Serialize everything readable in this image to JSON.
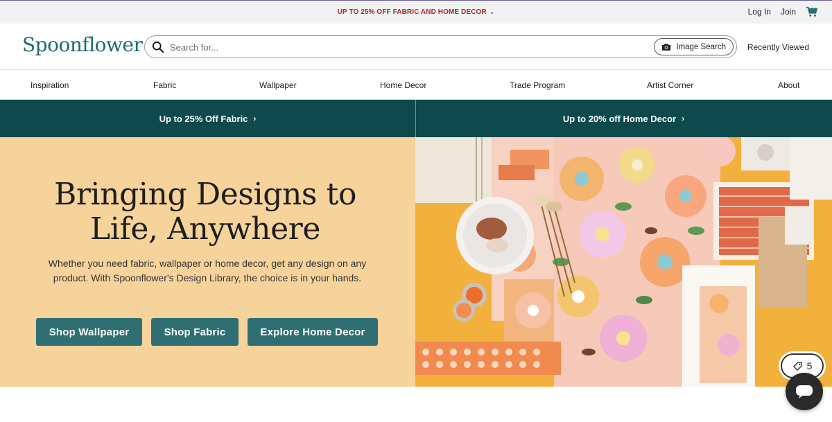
{
  "promo_bar": {
    "text": "UP TO 25% OFF FABRIC AND HOME DECOR",
    "chevron_icon": "chevron-down-icon"
  },
  "account": {
    "login": "Log In",
    "join": "Join",
    "cart_icon": "cart-icon"
  },
  "header": {
    "logo": "Spoonflower",
    "search": {
      "placeholder": "Search for...",
      "value": "",
      "image_search_label": "Image Search"
    },
    "recently_viewed": "Recently Viewed"
  },
  "nav": {
    "items": [
      {
        "label": "Inspiration"
      },
      {
        "label": "Fabric"
      },
      {
        "label": "Wallpaper"
      },
      {
        "label": "Home Decor"
      },
      {
        "label": "Trade Program"
      },
      {
        "label": "Artist Corner"
      },
      {
        "label": "About"
      }
    ]
  },
  "banners": [
    {
      "label": "Up to 25% Off Fabric"
    },
    {
      "label": "Up to 20% off Home Decor"
    }
  ],
  "hero": {
    "title": "Bringing Designs to Life, Anywhere",
    "text": "Whether you need fabric, wallpaper or home decor, get any design on any product. With Spoonflower's Design Library, the choice is in your hands.",
    "buttons": [
      {
        "label": "Shop Wallpaper"
      },
      {
        "label": "Shop Fabric"
      },
      {
        "label": "Explore Home Decor"
      }
    ]
  },
  "coupon_badge": {
    "count": "5",
    "icon": "tag-icon"
  },
  "chat": {
    "icon": "chat-bubble-icon"
  },
  "colors": {
    "brand_teal": "#1d6b6b",
    "banner_bg": "#0e4a4c",
    "hero_bg": "#f5d39b",
    "button_bg": "#2f6f73",
    "promo_red": "#b0262b"
  }
}
